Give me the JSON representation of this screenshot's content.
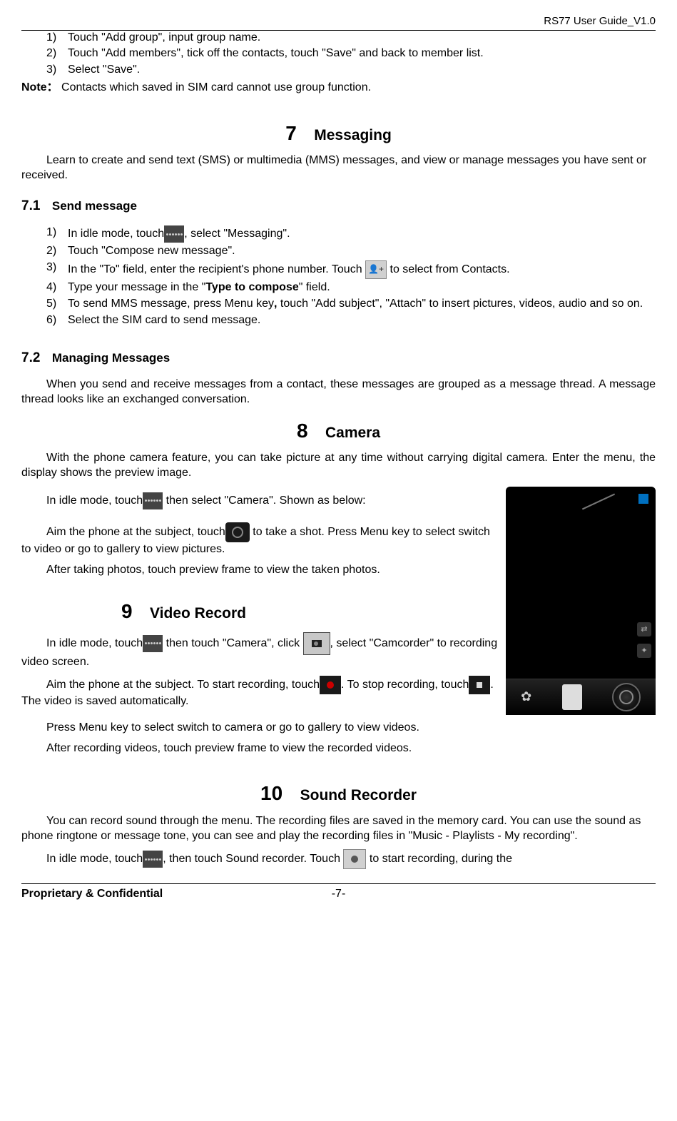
{
  "header": {
    "title": "RS77 User Guide_V1.0"
  },
  "intro_steps": {
    "items": [
      {
        "n": "1)",
        "t": "Touch \"Add group\", input group name."
      },
      {
        "n": "2)",
        "t": "Touch \"Add members\", tick off the contacts, touch \"Save\" and back to member list."
      },
      {
        "n": "3)",
        "t": "Select \"Save\"."
      }
    ],
    "note_label": "Note：",
    "note_text": "Contacts which saved in SIM card cannot use group function."
  },
  "s7": {
    "num": "7",
    "title": "Messaging",
    "intro": "Learn to create and send text (SMS) or multimedia (MMS) messages, and view or manage messages you have sent or received."
  },
  "s71": {
    "num": "7.1",
    "title": "Send message",
    "items": {
      "n1": "1)",
      "t1a": "In idle mode, touch",
      "t1b": ", select \"Messaging\".",
      "n2": "2)",
      "t2": "Touch \"Compose new message\".",
      "n3": "3)",
      "t3a": "In the \"To\" field, enter the recipient's phone number. Touch ",
      "t3b": " to select from Contacts.",
      "n4": "4)",
      "t4a": "Type your message in the \"",
      "t4bold": "Type to compose",
      "t4b": "\" field.",
      "n5": "5)",
      "t5a": "To send MMS message, press Menu key",
      "t5comma": ", ",
      "t5b": "touch \"Add subject\", \"Attach\" to insert pictures, videos, audio and so on.",
      "n6": "6)",
      "t6": "Select the SIM card to send message."
    }
  },
  "s72": {
    "num": "7.2",
    "title": "Managing Messages",
    "text": "When you send and receive messages from a contact, these messages are grouped as a message thread. A message thread looks like an exchanged conversation."
  },
  "s8": {
    "num": "8",
    "title": "Camera",
    "p1": "With the phone camera feature, you can take picture at any time without carrying digital camera. Enter the menu, the display shows the preview image.",
    "p2a": "In idle mode, touch",
    "p2b": " then select \"Camera\". Shown as below:",
    "p3a": "Aim the phone at the subject, touch",
    "p3b": " to take a shot. Press Menu key to select switch to video or go to gallery to view pictures.",
    "p4": "After taking photos, touch preview frame to view the taken photos."
  },
  "s9": {
    "num": "9",
    "title": "Video Record",
    "p1a": "In idle mode, touch",
    "p1b": " then touch \"Camera\", click ",
    "p1c": ", select \"Camcorder\" to recording video screen.",
    "p2a": "Aim the phone at the subject. To start recording, touch",
    "p2b": ". To stop recording, touch",
    "p2c": ". The video is saved automatically.",
    "p3": "Press Menu key to select switch to camera or go to gallery to view videos.",
    "p4": "After recording videos, touch preview frame to view the recorded videos."
  },
  "s10": {
    "num": "10",
    "title": "Sound Recorder",
    "p1": "You can record sound through the menu. The recording files are saved in the memory card. You can use the sound as phone ringtone or message tone, you can see and play the recording files in \"Music - Playlists - My recording\".",
    "p2a": "In idle mode, touch",
    "p2b": ", then touch Sound recorder. Touch ",
    "p2c": " to start recording, during the"
  },
  "footer": {
    "left": "Proprietary & Confidential",
    "center": "-7-"
  }
}
